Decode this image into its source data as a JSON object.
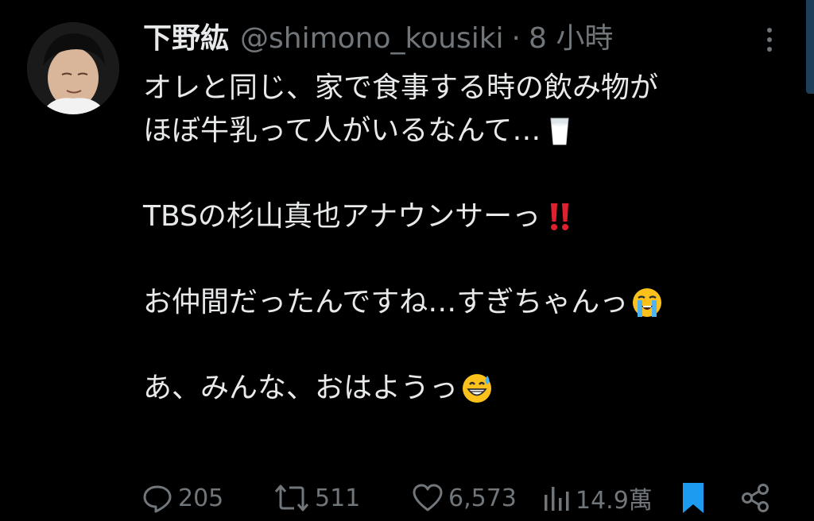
{
  "author": {
    "display_name": "下野紘",
    "handle": "@shimono_kousiki",
    "separator": "·",
    "time": "8 小時"
  },
  "tweet": {
    "lines": [
      "オレと同じ、家で食事する時の飲み物が",
      "ほぼ牛乳って人がいるなんて…",
      "",
      "TBSの杉山真也アナウンサーっ",
      "",
      "お仲間だったんですね…すぎちゃんっ",
      "",
      "あ、みんな、おはようっ"
    ],
    "emojis": [
      "glass-of-milk",
      "double-exclamation-mark",
      "loudly-crying-face",
      "grinning-face-with-sweat"
    ]
  },
  "actions": {
    "replies": "205",
    "retweets": "511",
    "likes": "6,573",
    "views": "14.9萬"
  },
  "colors": {
    "background": "#000000",
    "text": "#e7e9ea",
    "muted": "#71767b",
    "bookmark_active": "#1d9bf0"
  }
}
